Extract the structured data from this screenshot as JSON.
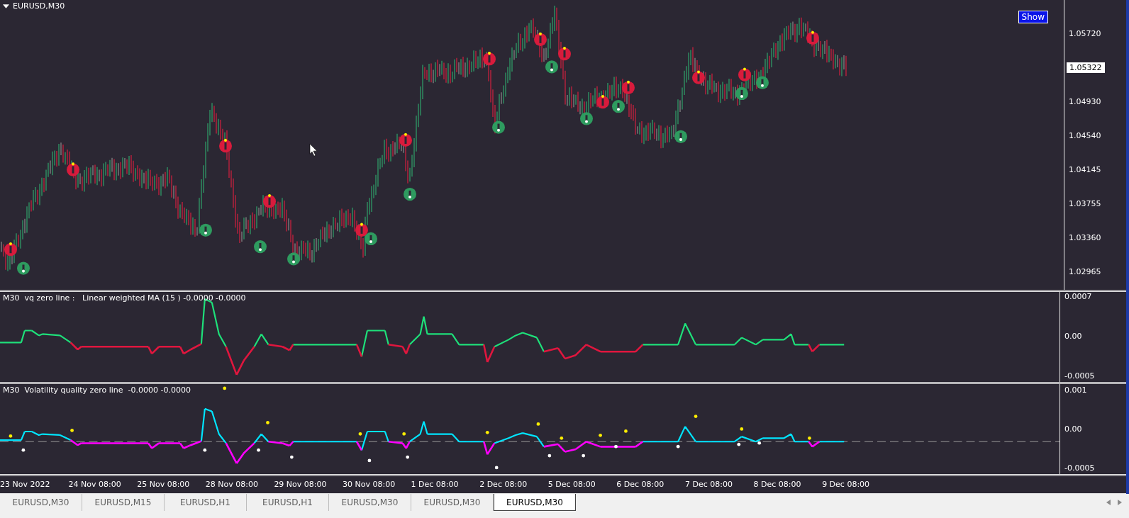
{
  "chart_title": "EURUSD,M30",
  "show_button": "Show",
  "price_axis": [
    {
      "kind": "tick",
      "label": "1.05720"
    },
    {
      "kind": "current",
      "label": "1.05322"
    },
    {
      "kind": "tick",
      "label": "1.04930"
    },
    {
      "kind": "tick",
      "label": "1.04540"
    },
    {
      "kind": "tick",
      "label": "1.04145"
    },
    {
      "kind": "tick",
      "label": "1.03755"
    },
    {
      "kind": "tick",
      "label": "1.03360"
    },
    {
      "kind": "tick",
      "label": "1.02965"
    }
  ],
  "indicators": [
    {
      "legend": "M30  vq zero line :   Linear weighted MA (15 ) -0.0000 -0.0000",
      "axis": [
        "0.0007",
        "0.00",
        "-0.0005"
      ]
    },
    {
      "legend": "M30  Volatility quality zero line  -0.0000 -0.0000",
      "axis": [
        "0.001",
        "0.00",
        "-0.0005"
      ]
    }
  ],
  "time_axis": [
    "23 Nov 2022",
    "24 Nov 08:00",
    "25 Nov 08:00",
    "28 Nov 08:00",
    "29 Nov 08:00",
    "30 Nov 08:00",
    "1 Dec 08:00",
    "2 Dec 08:00",
    "5 Dec 08:00",
    "6 Dec 08:00",
    "7 Dec 08:00",
    "8 Dec 08:00",
    "9 Dec 08:00"
  ],
  "tabs": [
    {
      "label": "EURUSD,M30",
      "selected": false
    },
    {
      "label": "EURUSD,M15",
      "selected": false
    },
    {
      "label": "EURUSD,H1",
      "selected": false
    },
    {
      "label": "EURUSD,H1",
      "selected": false
    },
    {
      "label": "EURUSD,M30",
      "selected": false
    },
    {
      "label": "EURUSD,M30",
      "selected": false
    },
    {
      "label": "EURUSD,M30",
      "selected": true
    }
  ]
}
